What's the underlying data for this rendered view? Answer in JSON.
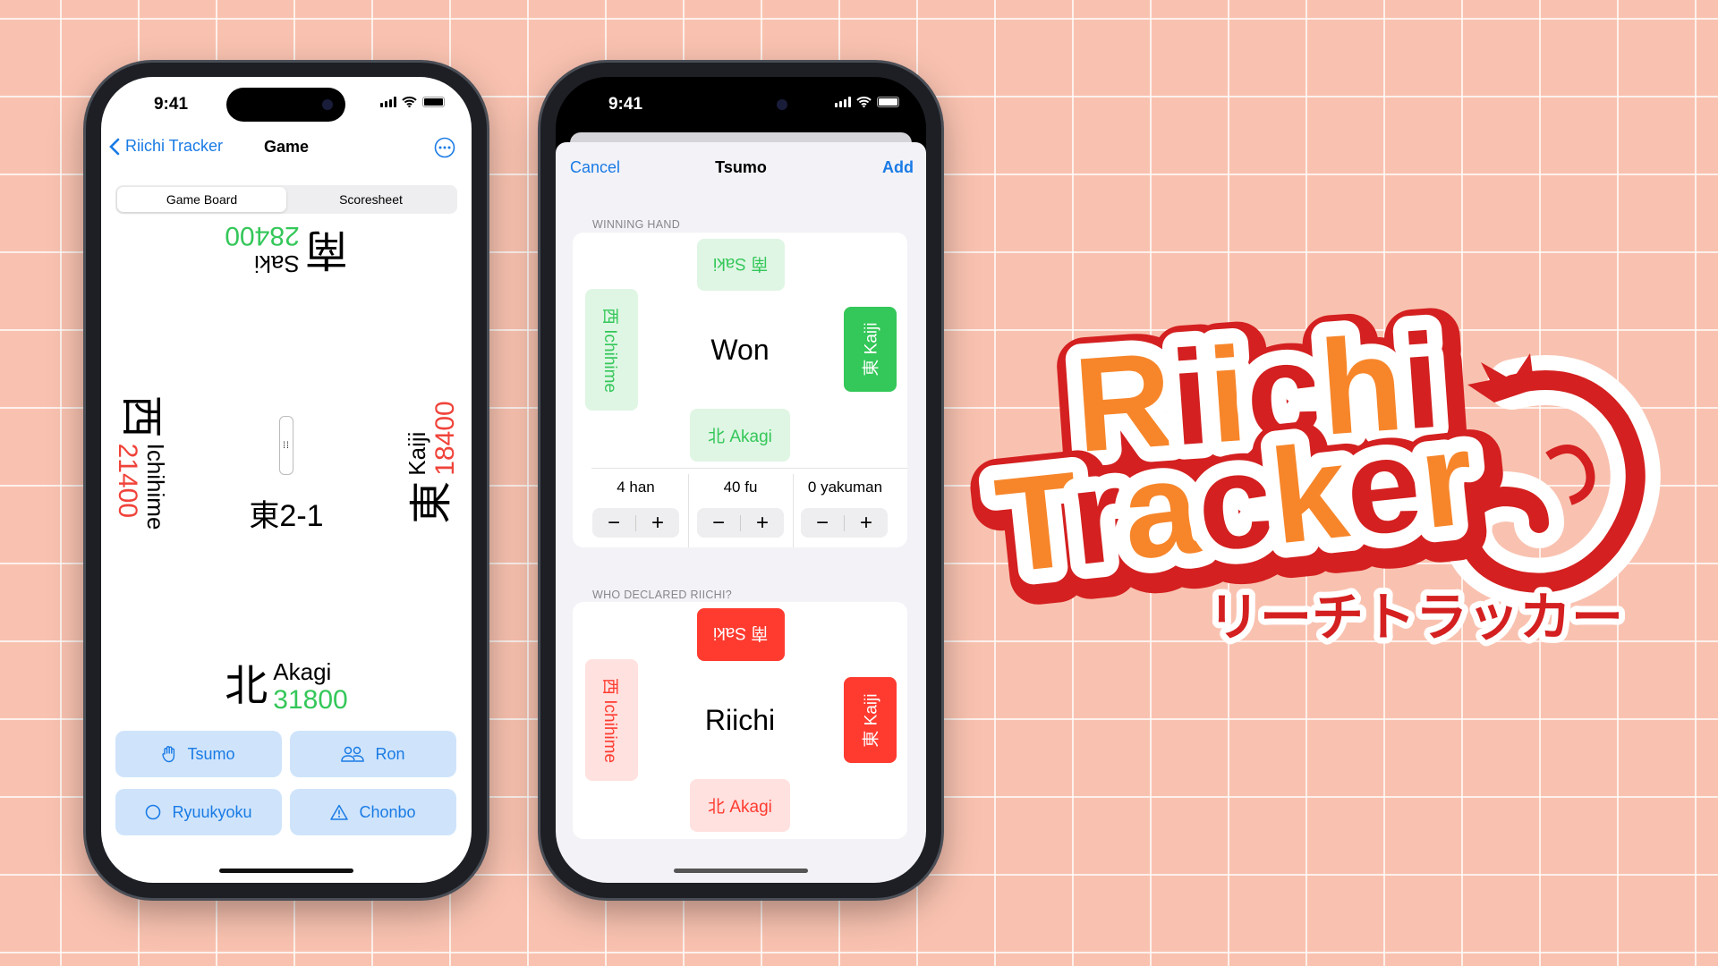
{
  "status": {
    "time": "9:41"
  },
  "game": {
    "nav": {
      "back": "Riichi Tracker",
      "title": "Game"
    },
    "segments": [
      "Game Board",
      "Scoresheet"
    ],
    "seats": {
      "south": {
        "wind": "南",
        "name": "Saki",
        "points": "28400",
        "points_color": "#34c759"
      },
      "west": {
        "wind": "西",
        "name": "Ichihime",
        "points": "21400",
        "points_color": "#f0433a"
      },
      "east": {
        "wind": "東",
        "name": "Kaiji",
        "points": "18400",
        "points_color": "#f0433a"
      },
      "north": {
        "wind": "北",
        "name": "Akagi",
        "points": "31800",
        "points_color": "#34c759"
      }
    },
    "round": "東2-1",
    "actions": [
      {
        "label": "Tsumo",
        "icon": "hand-raised-icon"
      },
      {
        "label": "Ron",
        "icon": "people-icon"
      },
      {
        "label": "Ryuukyoku",
        "icon": "circle-icon"
      },
      {
        "label": "Chonbo",
        "icon": "warning-triangle-icon"
      }
    ]
  },
  "tsumo": {
    "cancel": "Cancel",
    "title": "Tsumo",
    "add": "Add",
    "winning_header": "WINNING HAND",
    "winning": {
      "center": "Won",
      "south": "南 Saki",
      "west": "西 Ichihime",
      "east": "東 Kaiji",
      "north": "北 Akagi",
      "selected": "east"
    },
    "han": "4 han",
    "fu": "40 fu",
    "yakuman": "0 yakuman",
    "minus": "−",
    "plus": "+",
    "riichi_header": "WHO DECLARED RIICHI?",
    "riichi": {
      "center": "Riichi",
      "south": "南 Saki",
      "west": "西 Ichihime",
      "east": "東 Kaiji",
      "north": "北 Akagi",
      "selected": [
        "south",
        "east"
      ]
    }
  },
  "logo": {
    "line1": "Riichi",
    "line2": "Tracker",
    "katakana": "リーチトラッカー"
  },
  "colors": {
    "accent": "#1a7be5",
    "win": "#34c759",
    "riichi": "#ff3b30",
    "logo_orange": "#f7862a",
    "logo_red": "#d42020",
    "background": "#f9c2b0"
  }
}
